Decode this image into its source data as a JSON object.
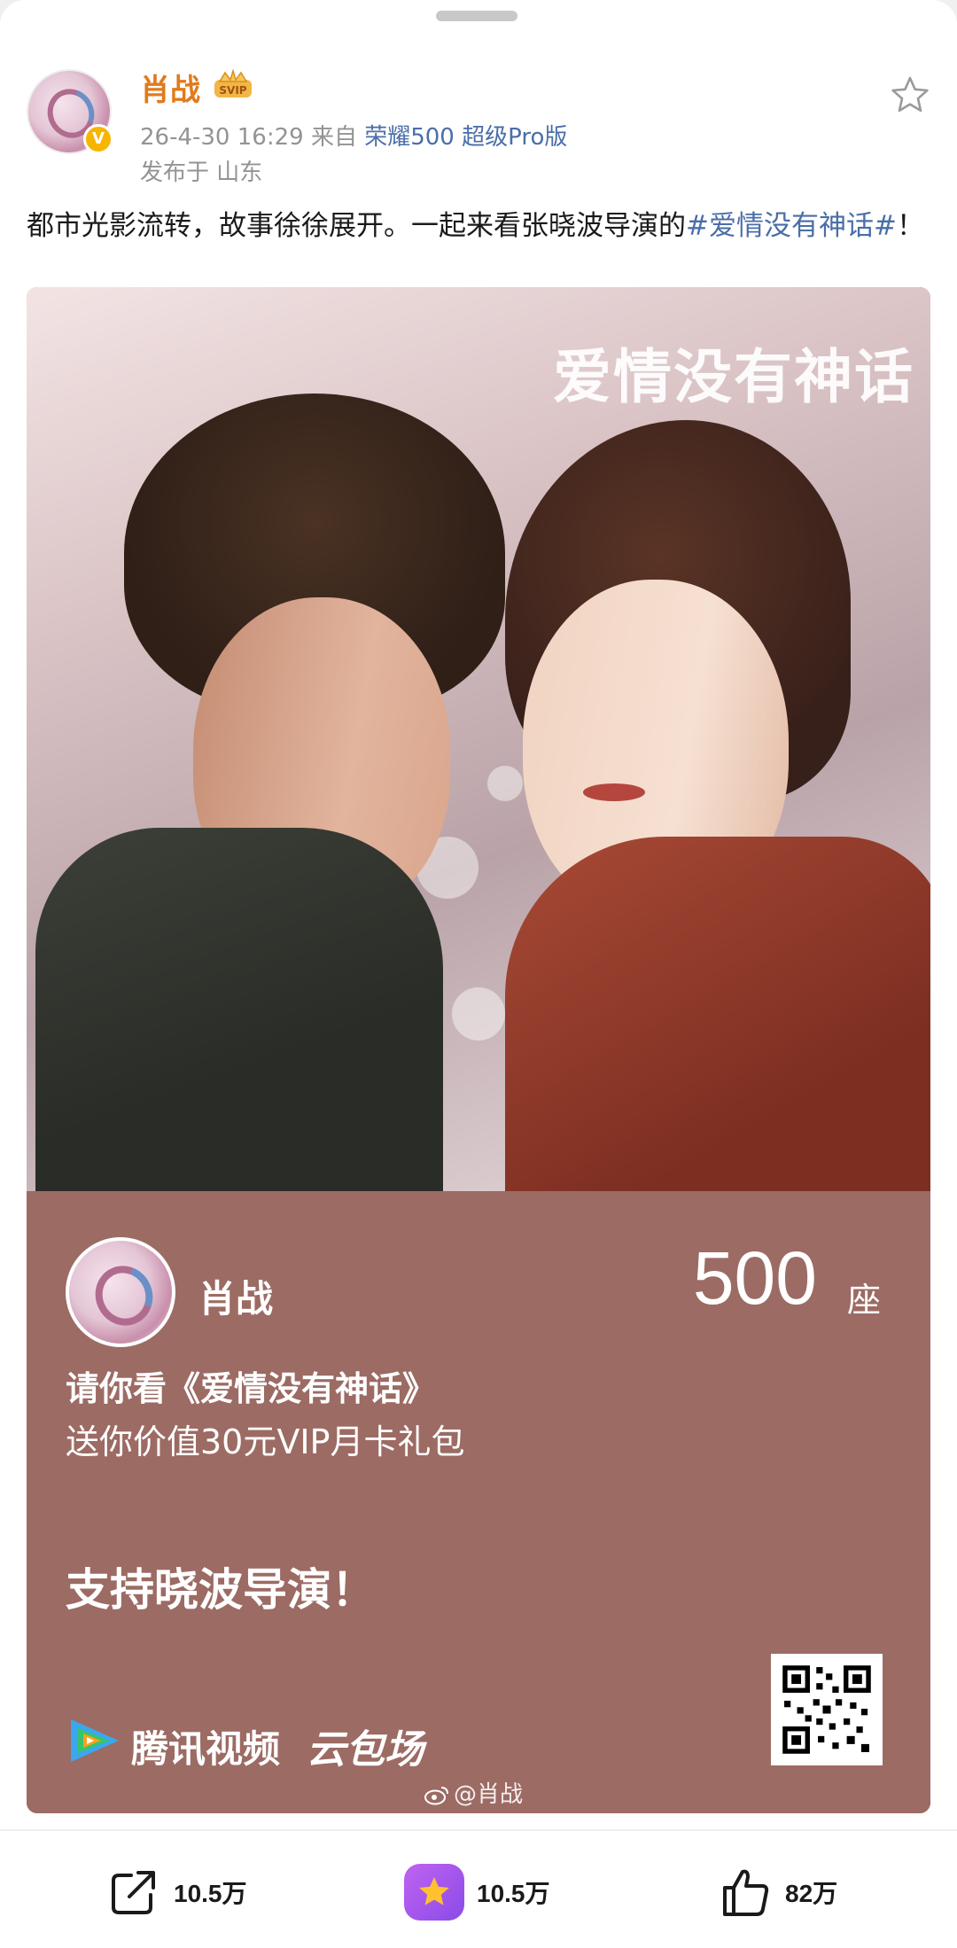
{
  "post": {
    "author": "肖战",
    "time": "26-4-30 16:29",
    "source_prefix": "来自",
    "source": "荣耀500 超级Pro版",
    "location": "发布于 山东",
    "text_prefix": "都市光影流转，故事徐徐展开。一起来看张晓波导演的",
    "topic": "#爱情没有神话#",
    "text_suffix": "！"
  },
  "card": {
    "poster_title": "爱情没有神话",
    "name": "肖战",
    "seat_count": "500",
    "seat_unit": "座",
    "invite": "请你看《爱情没有神话》",
    "gift": "送你价值30元VIP月卡礼包",
    "support": "支持晓波导演！",
    "brand": "腾讯视频",
    "brand_sub": "云包场",
    "watermark": "@肖战"
  },
  "actions": {
    "repost_count": "10.5万",
    "coin_count": "10.5万",
    "like_count": "82万"
  },
  "colors": {
    "username": "#e27a1c",
    "link": "#4a6ea8",
    "card_bg": "#9c6b64",
    "verified": "#f7b500",
    "coin_badge": "#a356ec"
  },
  "icons": [
    "star-icon",
    "verified-icon",
    "vip-crown-icon",
    "repost-icon",
    "coin-star-icon",
    "like-icon",
    "tencent-video-icon",
    "weibo-icon",
    "qr-code"
  ]
}
